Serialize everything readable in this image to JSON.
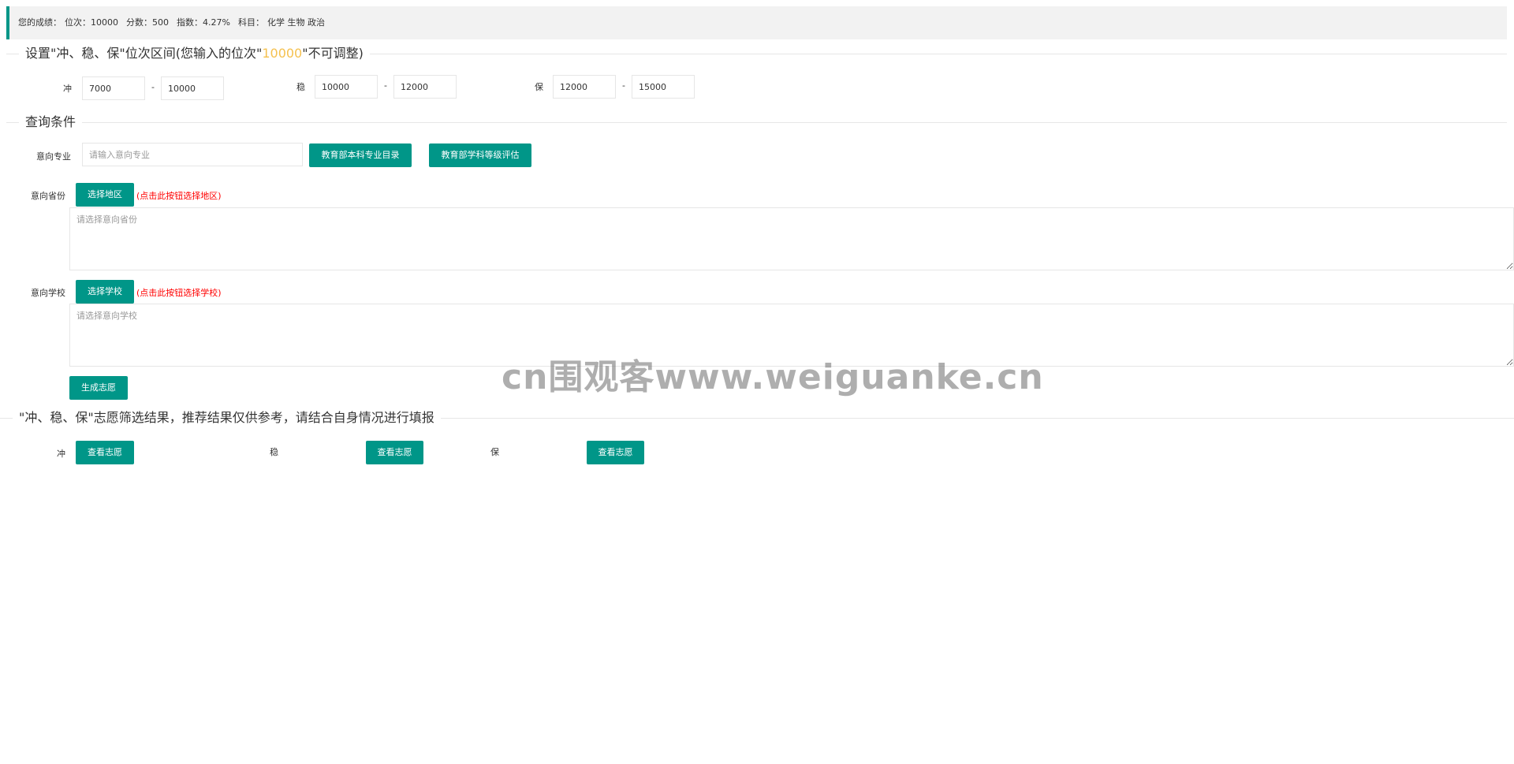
{
  "summary": {
    "prefix": "您的成绩：",
    "rank": "位次：10000",
    "score": "分数：500",
    "index": "指数：4.27%",
    "subjects": "科目：",
    "subject_values": "化学 生物 政治"
  },
  "range_section": {
    "title_before": "设置\"冲、稳、保\"位次区间(您输入的位次\"",
    "title_highlight": "10000",
    "title_after": "\"不可调整)",
    "chong_label": "冲",
    "chong_from": "7000",
    "chong_to": "10000",
    "wen_label": "稳",
    "wen_from": "10000",
    "wen_to": "12000",
    "bao_label": "保",
    "bao_from": "12000",
    "bao_to": "15000",
    "dash": "-"
  },
  "query_section": {
    "title": "查询条件",
    "major_label": "意向专业",
    "major_placeholder": "请输入意向专业",
    "major_catalog_button": "教育部本科专业目录",
    "discipline_eval_button": "教育部学科等级评估",
    "province_label": "意向省份",
    "province_button": "选择地区",
    "province_hint": "(点击此按钮选择地区)",
    "province_placeholder": "请选择意向省份",
    "school_label": "意向学校",
    "school_button": "选择学校",
    "school_hint": "(点击此按钮选择学校)",
    "school_placeholder": "请选择意向学校",
    "generate_button": "生成志愿"
  },
  "result_section": {
    "title": "\"冲、稳、保\"志愿筛选结果，推荐结果仅供参考，请结合自身情况进行填报",
    "chong_label": "冲",
    "wen_label": "稳",
    "bao_label": "保",
    "view_button": "查看志愿"
  },
  "watermark": "cn围观客www.weiguanke.cn",
  "colors": {
    "accent": "#009688",
    "highlight": "#f5c14f",
    "hint": "#ff0000"
  }
}
